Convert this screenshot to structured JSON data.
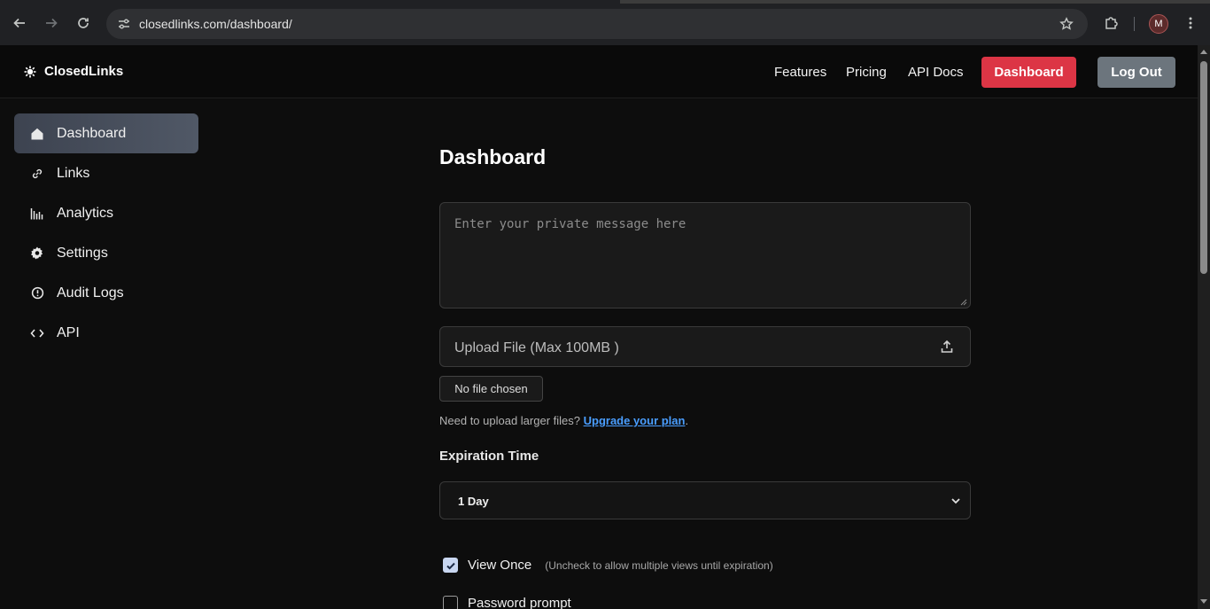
{
  "browser": {
    "url": "closedlinks.com/dashboard/",
    "profile_initial": "M"
  },
  "brand": {
    "name": "ClosedLinks"
  },
  "nav": {
    "links": [
      "Features",
      "Pricing",
      "API Docs"
    ],
    "dashboard_label": "Dashboard",
    "logout_label": "Log Out"
  },
  "sidebar": {
    "items": [
      {
        "label": "Dashboard",
        "icon": "home-icon",
        "active": true
      },
      {
        "label": "Links",
        "icon": "link-icon",
        "active": false
      },
      {
        "label": "Analytics",
        "icon": "analytics-icon",
        "active": false
      },
      {
        "label": "Settings",
        "icon": "gear-icon",
        "active": false
      },
      {
        "label": "Audit Logs",
        "icon": "alert-circle-icon",
        "active": false
      },
      {
        "label": "API",
        "icon": "code-icon",
        "active": false
      }
    ]
  },
  "main": {
    "title": "Dashboard",
    "message_placeholder": "Enter your private message here",
    "upload_label": "Upload File (Max 100MB )",
    "no_file_label": "No file chosen",
    "hint_text": "Need to upload larger files? ",
    "hint_link": "Upgrade your plan",
    "hint_end": ".",
    "expiration_label": "Expiration Time",
    "expiration_value": "1 Day",
    "view_once_label": "View Once",
    "view_once_note": "(Uncheck to allow multiple views until expiration)",
    "view_once_checked": true,
    "password_label": "Password prompt",
    "password_checked": false
  },
  "colors": {
    "accent_red": "#dc3545",
    "logout_gray": "#6c757d",
    "link_blue": "#4a9eff"
  }
}
